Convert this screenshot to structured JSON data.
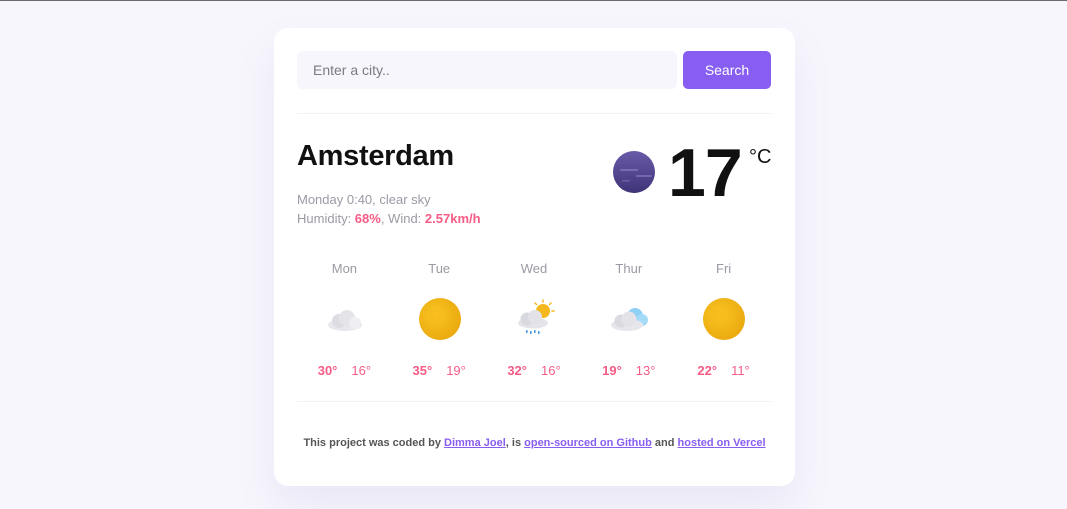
{
  "search": {
    "placeholder": "Enter a city..",
    "button_label": "Search"
  },
  "current": {
    "city": "Amsterdam",
    "date_desc": "Monday 0:40, clear sky",
    "humidity_label": "Humidity: ",
    "humidity_value": "68%",
    "wind_label": ", Wind: ",
    "wind_value": "2.57km/h",
    "temperature": "17",
    "unit": "°C",
    "icon": "moon-icon"
  },
  "forecast": [
    {
      "day": "Mon",
      "icon": "cloud-icon",
      "max": "30°",
      "min": "16°"
    },
    {
      "day": "Tue",
      "icon": "sun-icon",
      "max": "35°",
      "min": "19°"
    },
    {
      "day": "Wed",
      "icon": "rain-sun-icon",
      "max": "32°",
      "min": "16°"
    },
    {
      "day": "Thur",
      "icon": "cloud-icon",
      "max": "19°",
      "min": "13°"
    },
    {
      "day": "Fri",
      "icon": "sun-icon",
      "max": "22°",
      "min": "11°"
    }
  ],
  "footer": {
    "text1": "This project was coded by ",
    "author": "Dimma Joel",
    "text2": ", is ",
    "link_github": "open-sourced on Github",
    "text3": " and ",
    "link_vercel": "hosted on Vercel"
  },
  "colors": {
    "accent": "#885df1",
    "highlight": "#f65c85",
    "background": "#f7f6fd"
  }
}
